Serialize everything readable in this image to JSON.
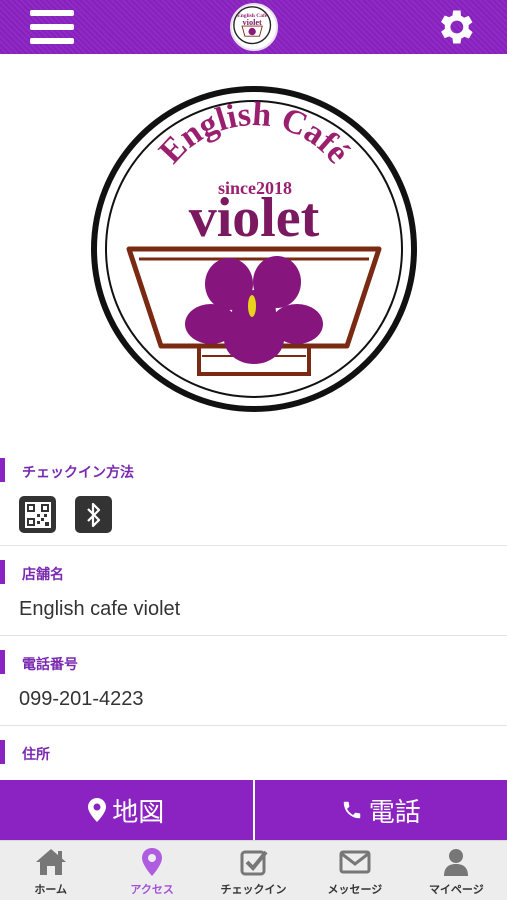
{
  "header": {
    "menu_icon": "hamburger-menu-icon",
    "settings_icon": "gear-icon",
    "logo_text_small": "violet"
  },
  "hero_logo": {
    "line1": "English Café",
    "line2": "since2018",
    "line3": "violet"
  },
  "sections": {
    "checkin": {
      "title": "チェックイン方法",
      "icons": [
        "qr-code-icon",
        "bluetooth-icon"
      ]
    },
    "store_name": {
      "title": "店舗名",
      "value": "English cafe violet"
    },
    "phone": {
      "title": "電話番号",
      "value": "099-201-4223"
    },
    "address": {
      "title": "住所"
    }
  },
  "actions": {
    "map_label": "地図",
    "call_label": "電話"
  },
  "bottom_nav": {
    "items": [
      {
        "label": "ホーム",
        "icon": "home-icon"
      },
      {
        "label": "アクセス",
        "icon": "location-pin-icon",
        "active": true
      },
      {
        "label": "チェックイン",
        "icon": "checkin-icon"
      },
      {
        "label": "メッセージ",
        "icon": "mail-icon"
      },
      {
        "label": "マイページ",
        "icon": "user-icon"
      }
    ]
  },
  "colors": {
    "brand": "#8b22c2",
    "accent_text": "#7a2ab0",
    "active_nav": "#a44fd8"
  }
}
